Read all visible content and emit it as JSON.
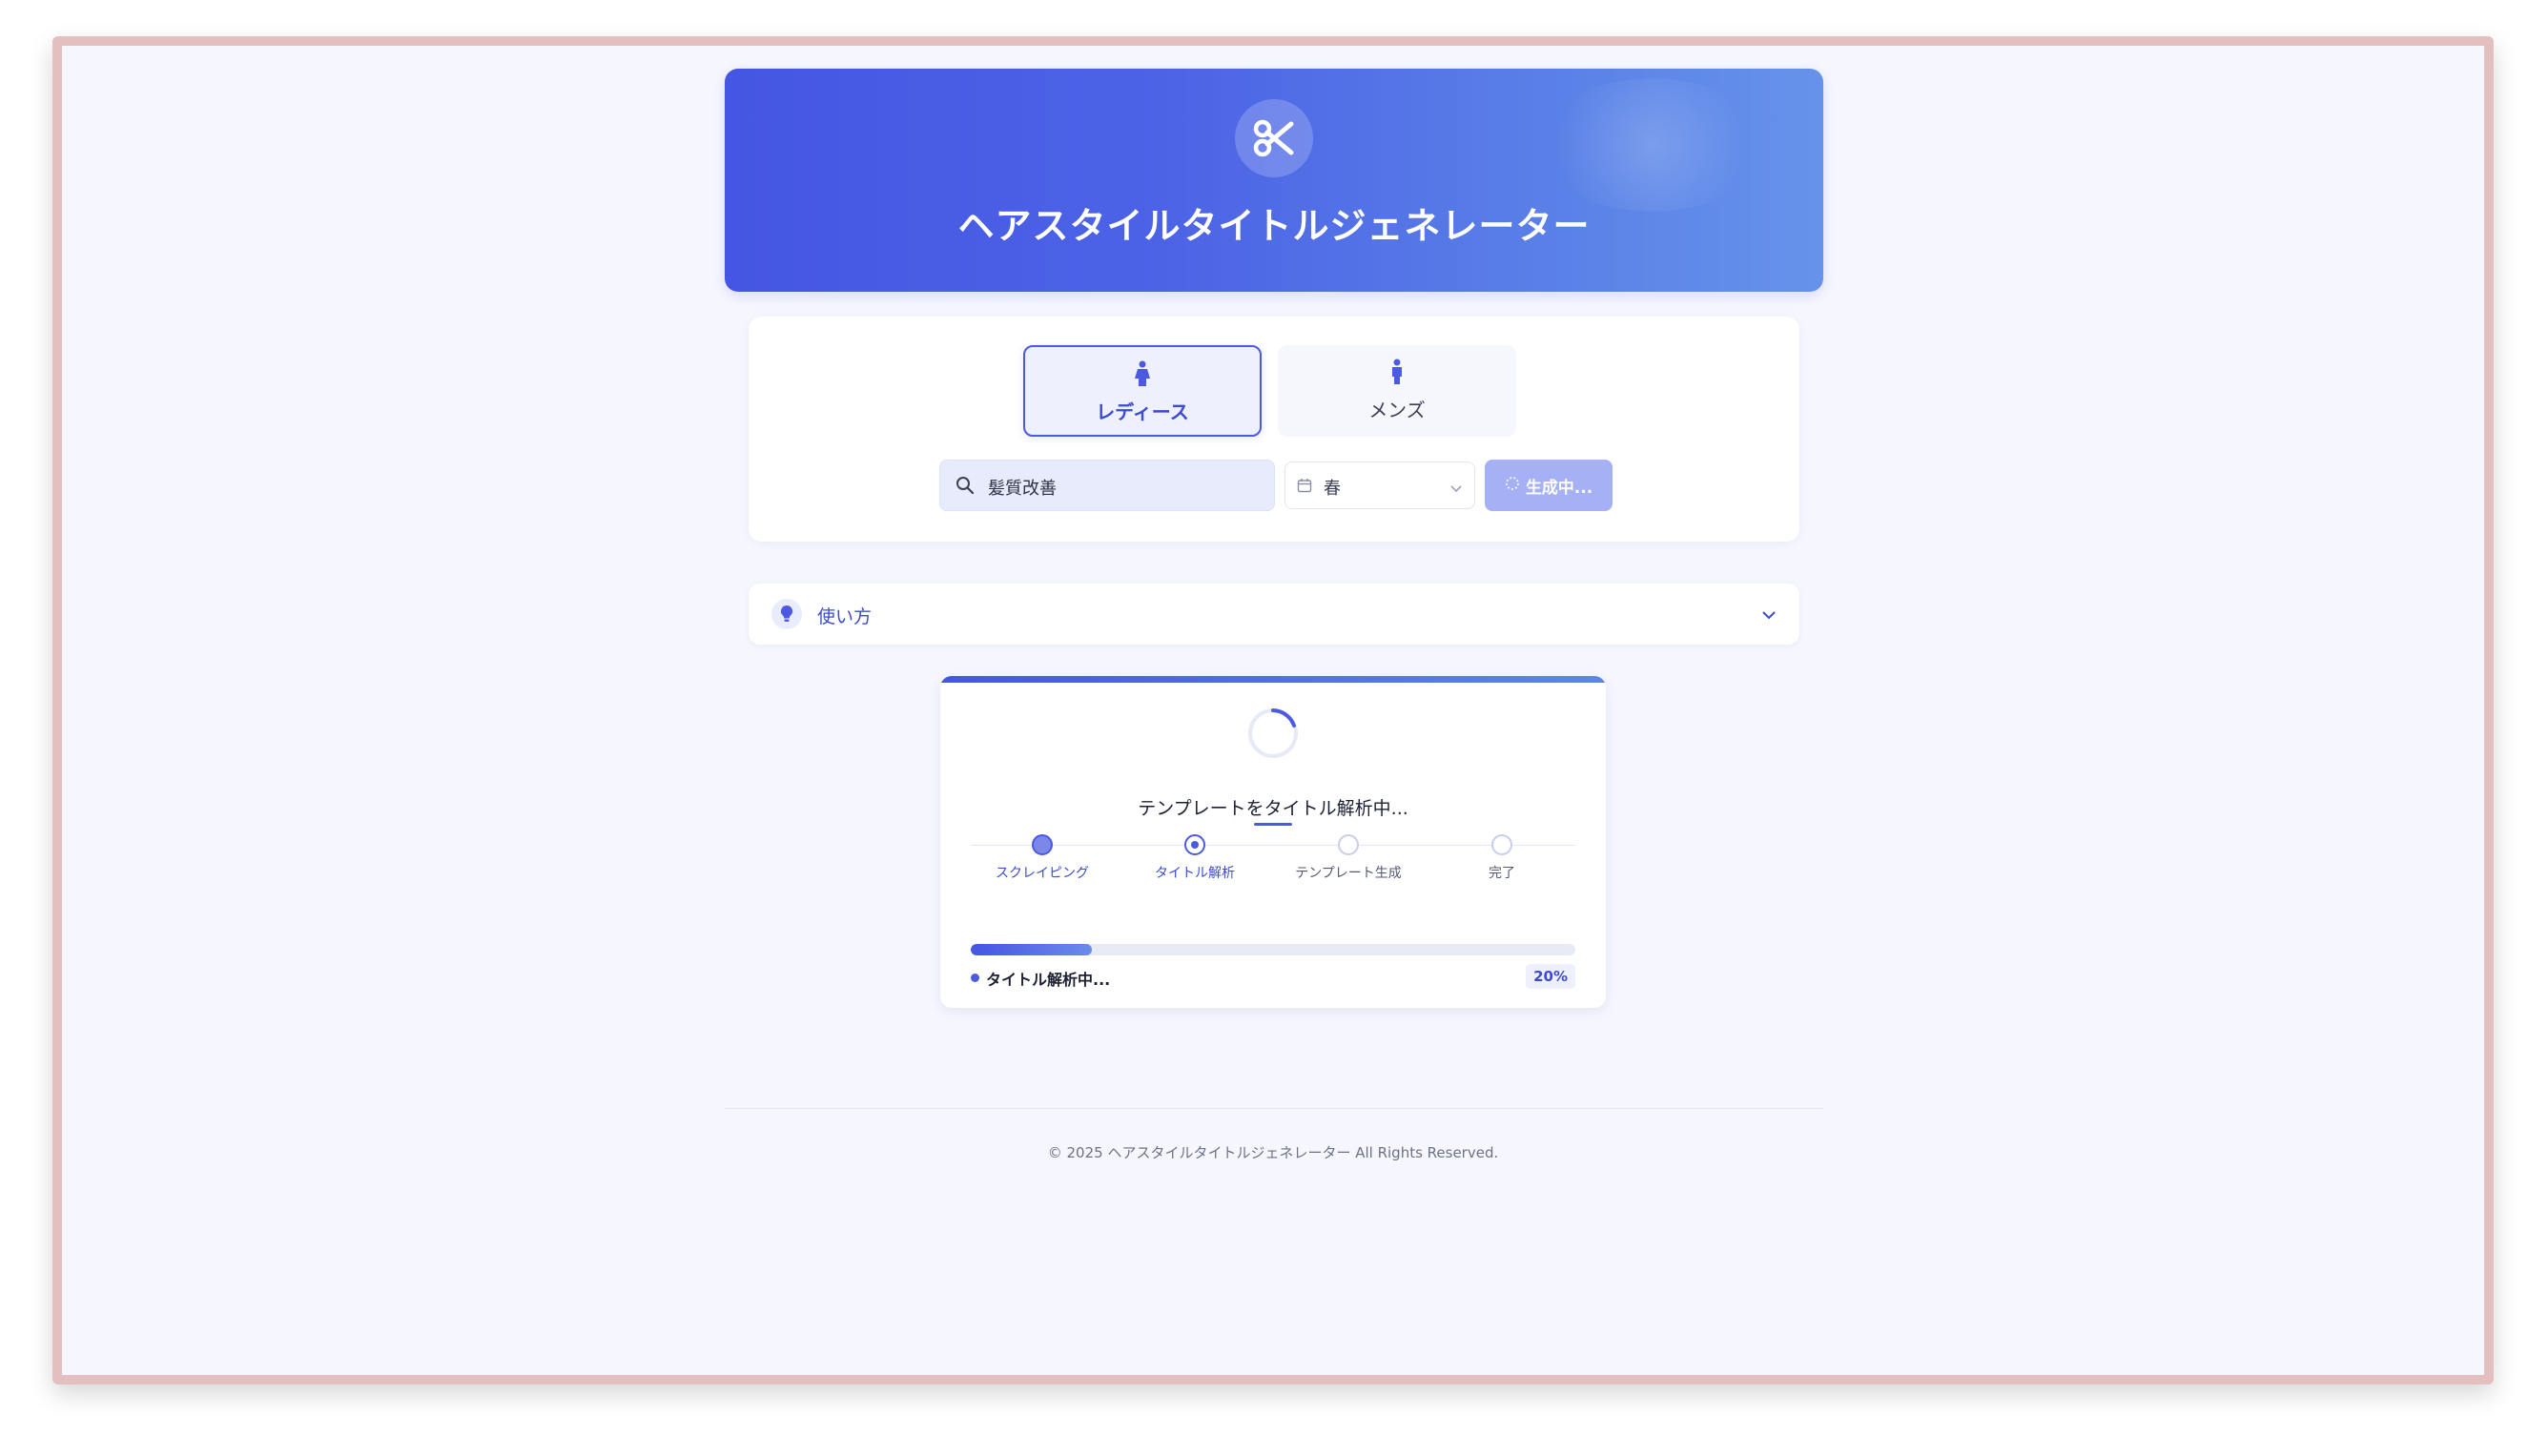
{
  "header": {
    "title": "ヘアスタイルタイトルジェネレーター",
    "icon": "scissors-icon"
  },
  "gender_tabs": [
    {
      "label": "レディース",
      "icon": "female-icon",
      "active": true
    },
    {
      "label": "メンズ",
      "icon": "male-icon",
      "active": false
    }
  ],
  "search": {
    "value": "髪質改善",
    "icon": "search-icon"
  },
  "season": {
    "value": "春",
    "icon": "calendar-icon"
  },
  "generate_button": {
    "label": "生成中..."
  },
  "usage": {
    "label": "使い方",
    "icon": "lightbulb-icon"
  },
  "progress": {
    "title": "テンプレートをタイトル解析中...",
    "steps": [
      {
        "label": "スクレイピング",
        "state": "done"
      },
      {
        "label": "タイトル解析",
        "state": "current"
      },
      {
        "label": "テンプレート生成",
        "state": "pending"
      },
      {
        "label": "完了",
        "state": "pending"
      }
    ],
    "percent": 20,
    "percent_label": "20%",
    "status": "タイトル解析中..."
  },
  "footer": {
    "text": "© 2025 ヘアスタイルタイトルジェネレーター All Rights Reserved."
  },
  "colors": {
    "accent": "#4b5ae0",
    "button_disabled": "#a6b0f5",
    "background": "#f6f7fe"
  }
}
